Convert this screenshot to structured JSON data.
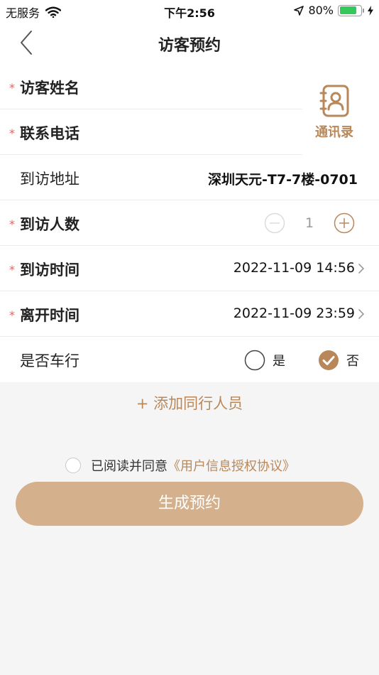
{
  "status_bar": {
    "carrier": "无服务",
    "time": "下午2:56",
    "battery_percent": "80%",
    "battery_level": 0.8
  },
  "nav": {
    "title": "访客预约",
    "back_icon": "chevron-left-icon"
  },
  "form": {
    "visitor_name": {
      "label": "访客姓名",
      "required": true
    },
    "phone": {
      "label": "联系电话",
      "required": true
    },
    "contacts": {
      "label": "通讯录",
      "icon": "contact-book-icon"
    },
    "address": {
      "label": "到访地址",
      "value": "深圳天元-T7-7楼-0701"
    },
    "visitor_count": {
      "label": "到访人数",
      "required": true,
      "value": "1",
      "minus_icon": "minus-circle-icon",
      "plus_icon": "plus-circle-icon"
    },
    "arrival_time": {
      "label": "到访时间",
      "required": true,
      "value": "2022-11-09 14:56"
    },
    "leave_time": {
      "label": "离开时间",
      "required": true,
      "value": "2022-11-09 23:59"
    },
    "has_car": {
      "label": "是否车行",
      "options": [
        {
          "label": "是",
          "selected": false
        },
        {
          "label": "否",
          "selected": true
        }
      ]
    },
    "required_mark": "*"
  },
  "add_companion": "+ 添加同行人员",
  "agreement": {
    "text": "已阅读并同意",
    "link": "《用户信息授权协议》",
    "checked": false
  },
  "submit_label": "生成预约",
  "colors": {
    "accent": "#b9885a",
    "button": "#d4b08c",
    "required": "#e0655a",
    "selected_radio": "#b9885a"
  }
}
